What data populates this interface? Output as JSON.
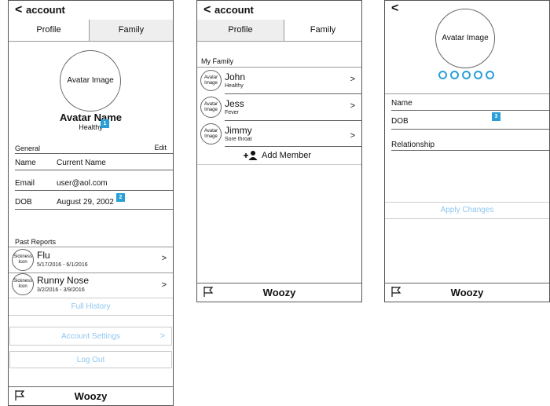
{
  "screen1": {
    "header": {
      "back": "<",
      "title": "account"
    },
    "tabs": [
      "Profile",
      "Family"
    ],
    "avatar": {
      "label": "Avatar Image",
      "name": "Avatar Name",
      "status": "Healthy"
    },
    "general": {
      "heading": "General",
      "edit": "Edit"
    },
    "fields": [
      {
        "label": "Name",
        "value": "Current Name"
      },
      {
        "label": "Email",
        "value": "user@aol.com"
      },
      {
        "label": "DOB",
        "value": "August 29, 2002"
      }
    ],
    "badges": [
      "1",
      "2"
    ],
    "past_reports": {
      "heading": "Past Reports",
      "items": [
        {
          "icon": "Sickness Icon",
          "title": "Flu",
          "dates": "5/17/2016 - 6/1/2016",
          "chev": ">"
        },
        {
          "icon": "Sickness Icon",
          "title": "Runny Nose",
          "dates": "3/2/2016 - 3/9/2016",
          "chev": ">"
        }
      ],
      "full_history": "Full History"
    },
    "account_settings": "Account Settings",
    "account_chev": ">",
    "logout": "Log Out",
    "footer": "Woozy"
  },
  "screen2": {
    "header": {
      "back": "<",
      "title": "account"
    },
    "tabs": [
      "Profile",
      "Family"
    ],
    "my_family": "My Family",
    "members": [
      {
        "avatar": "Avatar Image",
        "name": "John",
        "status": "Healthy",
        "chev": ">"
      },
      {
        "avatar": "Avatar Image",
        "name": "Jess",
        "status": "Fever",
        "chev": ">"
      },
      {
        "avatar": "Avatar Image",
        "name": "Jimmy",
        "status": "Sore throat",
        "chev": ">"
      }
    ],
    "add_member": "Add Member",
    "footer": "Woozy"
  },
  "screen3": {
    "back": "<",
    "avatar": "Avatar Image",
    "dots": 5,
    "fields": [
      "Name",
      "DOB",
      "Relationship"
    ],
    "badge": "3",
    "apply": "Apply Changes",
    "footer": "Woozy"
  },
  "colors": {
    "accent": "#2a9fd6",
    "light_link": "#8fc6f0"
  }
}
